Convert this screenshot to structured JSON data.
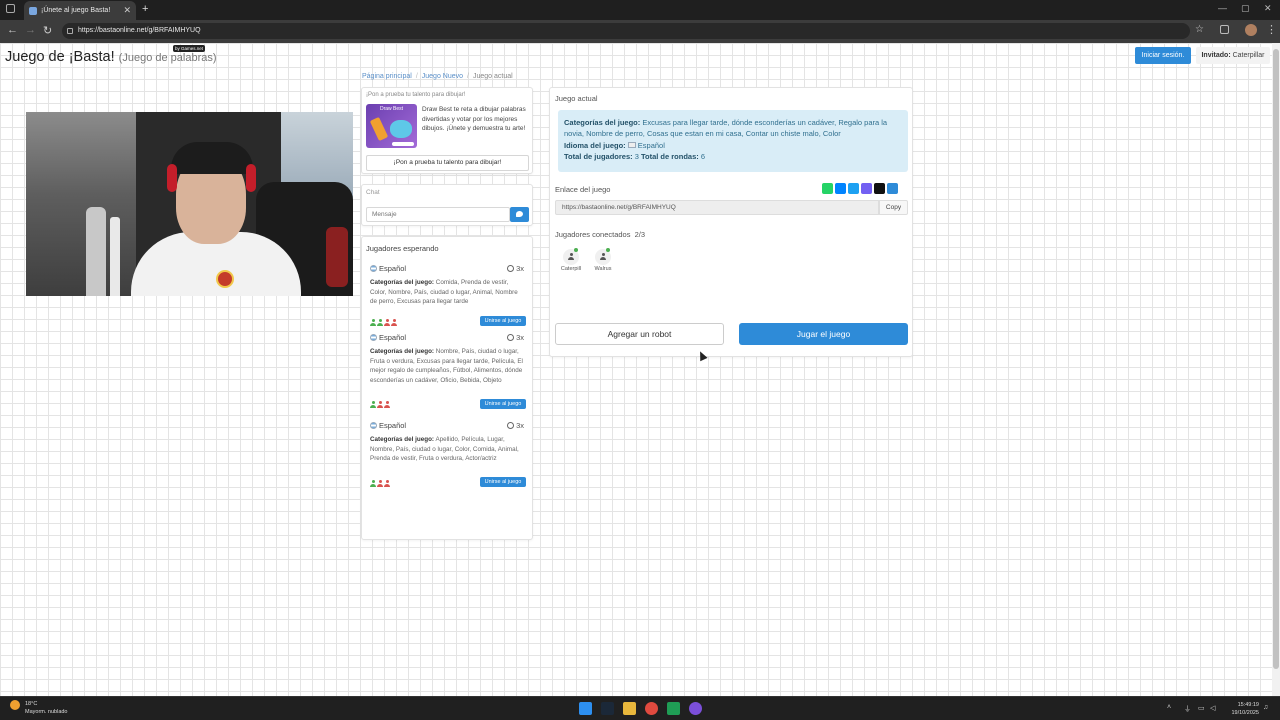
{
  "browser": {
    "tab_title": "¡Únete al juego Basta!",
    "tab_close": "✕",
    "new_tab": "+",
    "url": "https://bastaonline.net/g/BRFAIMHYUQ",
    "back": "←",
    "forward": "→",
    "reload": "↻",
    "star": "☆",
    "menu": "⋮",
    "minimize": "—",
    "maximize": "▢",
    "close": "✕"
  },
  "header": {
    "title": "Juego de ¡Basta!",
    "subtitle": "(Juego de palabras)",
    "by_badge": "by Games.net",
    "login_label": "Iniciar sesión.",
    "guest_label": "Invitado:",
    "guest_name": "Caterpillar"
  },
  "breadcrumb": [
    "Página principal",
    "Juego Nuevo",
    "Juego actual"
  ],
  "promo": {
    "heading": "¡Pon a prueba tu talento para dibujar!",
    "image_title": "Draw Best",
    "description": "Draw Best te reta a dibujar palabras divertidas y votar por los mejores dibujos. ¡Únete y demuestra tu arte!",
    "cta": "¡Pon a prueba tu talento para dibujar!"
  },
  "chat": {
    "title": "Chat",
    "placeholder": "Mensaje"
  },
  "waiting": {
    "title": "Jugadores esperando",
    "join_label": "Unirse al juego",
    "categories_label": "Categorías del juego:",
    "games": [
      {
        "language": "Español",
        "rounds": "3x",
        "categories": "Comida, Prenda de vestir, Color, Nombre, País, ciudad o lugar, Animal, Nombre de perro, Excusas para llegar tarde",
        "players": [
          "g",
          "g",
          "r",
          "r"
        ]
      },
      {
        "language": "Español",
        "rounds": "3x",
        "categories": "Nombre, País, ciudad o lugar, Fruta o verdura, Excusas para llegar tarde, Película, El mejor regalo de cumpleaños, Fútbol, Alimentos, dónde esconderías un cadáver, Oficio, Bebida, Objeto",
        "players": [
          "g",
          "r",
          "r"
        ]
      },
      {
        "language": "Español",
        "rounds": "3x",
        "categories": "Apellido, Película, Lugar, Nombre, País, ciudad o lugar, Color, Comida, Animal, Prenda de vestir, Fruta o verdura, Actor/actriz",
        "players": [
          "g",
          "r",
          "r"
        ]
      }
    ]
  },
  "current_game": {
    "title": "Juego actual",
    "categories_label": "Categorías del juego:",
    "categories": "Excusas para llegar tarde, dónde esconderías un cadáver, Regalo para la novia, Nombre de perro, Cosas que estan en mi casa, Contar un chiste malo, Color",
    "language_label": "Idioma del juego:",
    "language": "Español",
    "players_label": "Total de jugadores:",
    "players_value": "3",
    "rounds_label": "Total de rondas:",
    "rounds_value": "6",
    "link_label": "Enlace del juego",
    "link": "https://bastaonline.net/g/BRFAIMHYUQ",
    "copy_label": "Copy",
    "connected_label": "Jugadores conectados",
    "connected_count": "2/3",
    "players": [
      {
        "name": "Caterpill",
        "status_color": "#4caf50"
      },
      {
        "name": "Walrus",
        "status_color": "#4caf50"
      }
    ],
    "add_robot": "Agregar un robot",
    "play": "Jugar el juego",
    "share_colors": [
      "#25d366",
      "#0084ff",
      "#1da1f2",
      "#7360f2",
      "#111111",
      "#2e8bd8"
    ]
  },
  "taskbar": {
    "temp": "18°C",
    "weather": "Mayorm. nublado",
    "time": "15:49:19",
    "date": "19/10/2025"
  }
}
